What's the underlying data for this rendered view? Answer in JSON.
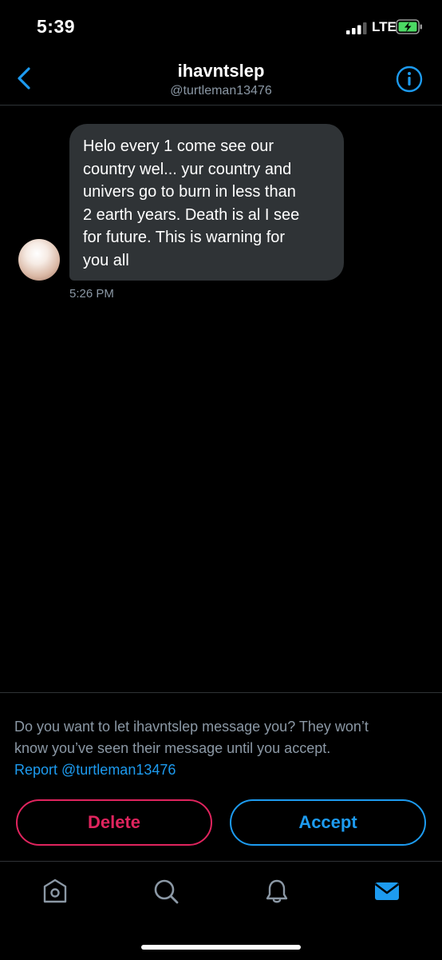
{
  "status_bar": {
    "time": "5:39",
    "network": "LTE"
  },
  "header": {
    "title": "ihavntslep",
    "handle": "@turtleman13476"
  },
  "message": {
    "lines": [
      "Helo every 1 come see our",
      "country wel... yur country and",
      "univers go to burn in less than",
      "2 earth years. Death is al I see",
      "for future. This is warning for",
      "you all"
    ],
    "time": "5:26 PM"
  },
  "request": {
    "line1": "Do you want to let ihavntslep message you? They won’t",
    "line2": "know you’ve seen their message until you accept.",
    "report_label": "Report @turtleman13476",
    "delete_label": "Delete",
    "accept_label": "Accept"
  },
  "tabs": [
    "home-icon",
    "search-icon",
    "notifications-icon",
    "messages-icon"
  ],
  "colors": {
    "accent": "#1d9bf0",
    "danger": "#e0245e",
    "bubble": "#2f3336",
    "muted": "#8b98a5"
  }
}
